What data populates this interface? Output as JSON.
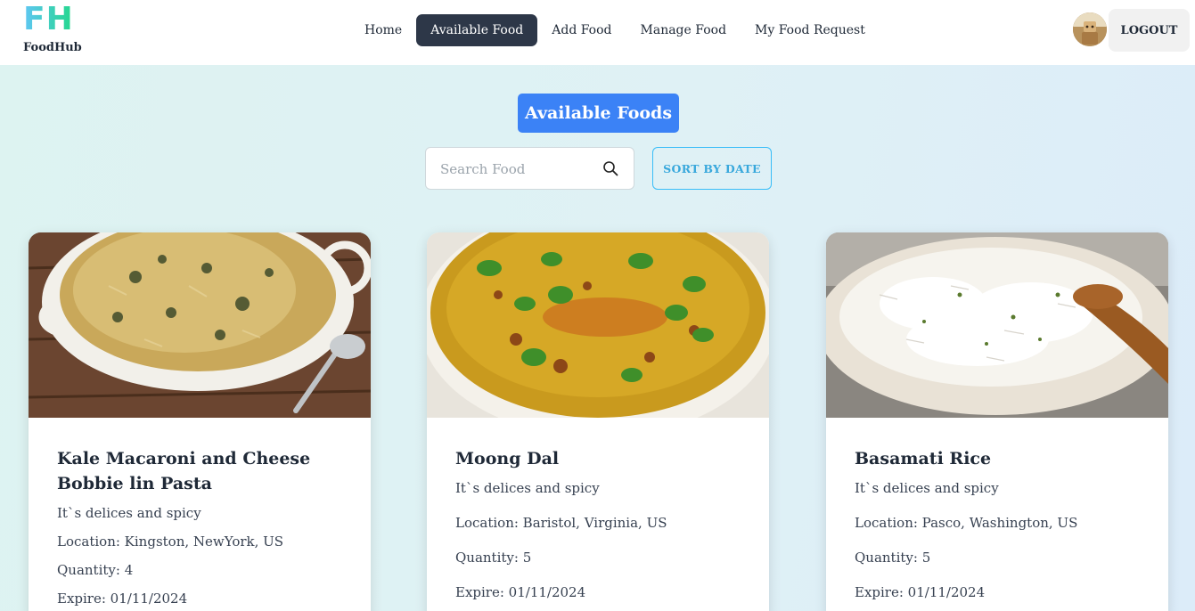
{
  "brand": {
    "mark": "FH",
    "name": "FoodHub"
  },
  "nav": {
    "items": [
      {
        "label": "Home",
        "active": false
      },
      {
        "label": "Available Food",
        "active": true
      },
      {
        "label": "Add Food",
        "active": false
      },
      {
        "label": "Manage Food",
        "active": false
      },
      {
        "label": "My Food Request",
        "active": false
      }
    ],
    "logout_label": "LOGOUT"
  },
  "page": {
    "title": "Available Foods",
    "search_placeholder": "Search Food",
    "sort_label": "SORT BY DATE"
  },
  "colors": {
    "accent": "#3b82f6",
    "nav_active": "#2d3748",
    "sort_border": "#38bdf8"
  },
  "foods": [
    {
      "name": "Kale Macaroni and Cheese Bobbie lin Pasta",
      "note": "It`s delices and spicy",
      "location": "Location: Kingston, NewYork, US",
      "quantity": "Quantity: 4",
      "expire": "Expire: 01/11/2024",
      "image": "baked-pasta-dish"
    },
    {
      "name": "Moong Dal",
      "note": "It`s delices and spicy",
      "location": "Location: Baristol, Virginia, US",
      "quantity": "Quantity: 5",
      "expire": "Expire: 01/11/2024",
      "image": "dal-bowl"
    },
    {
      "name": "Basamati Rice",
      "note": "It`s delices and spicy",
      "location": "Location: Pasco, Washington, US",
      "quantity": "Quantity: 5",
      "expire": "Expire: 01/11/2024",
      "image": "rice-plate"
    }
  ]
}
